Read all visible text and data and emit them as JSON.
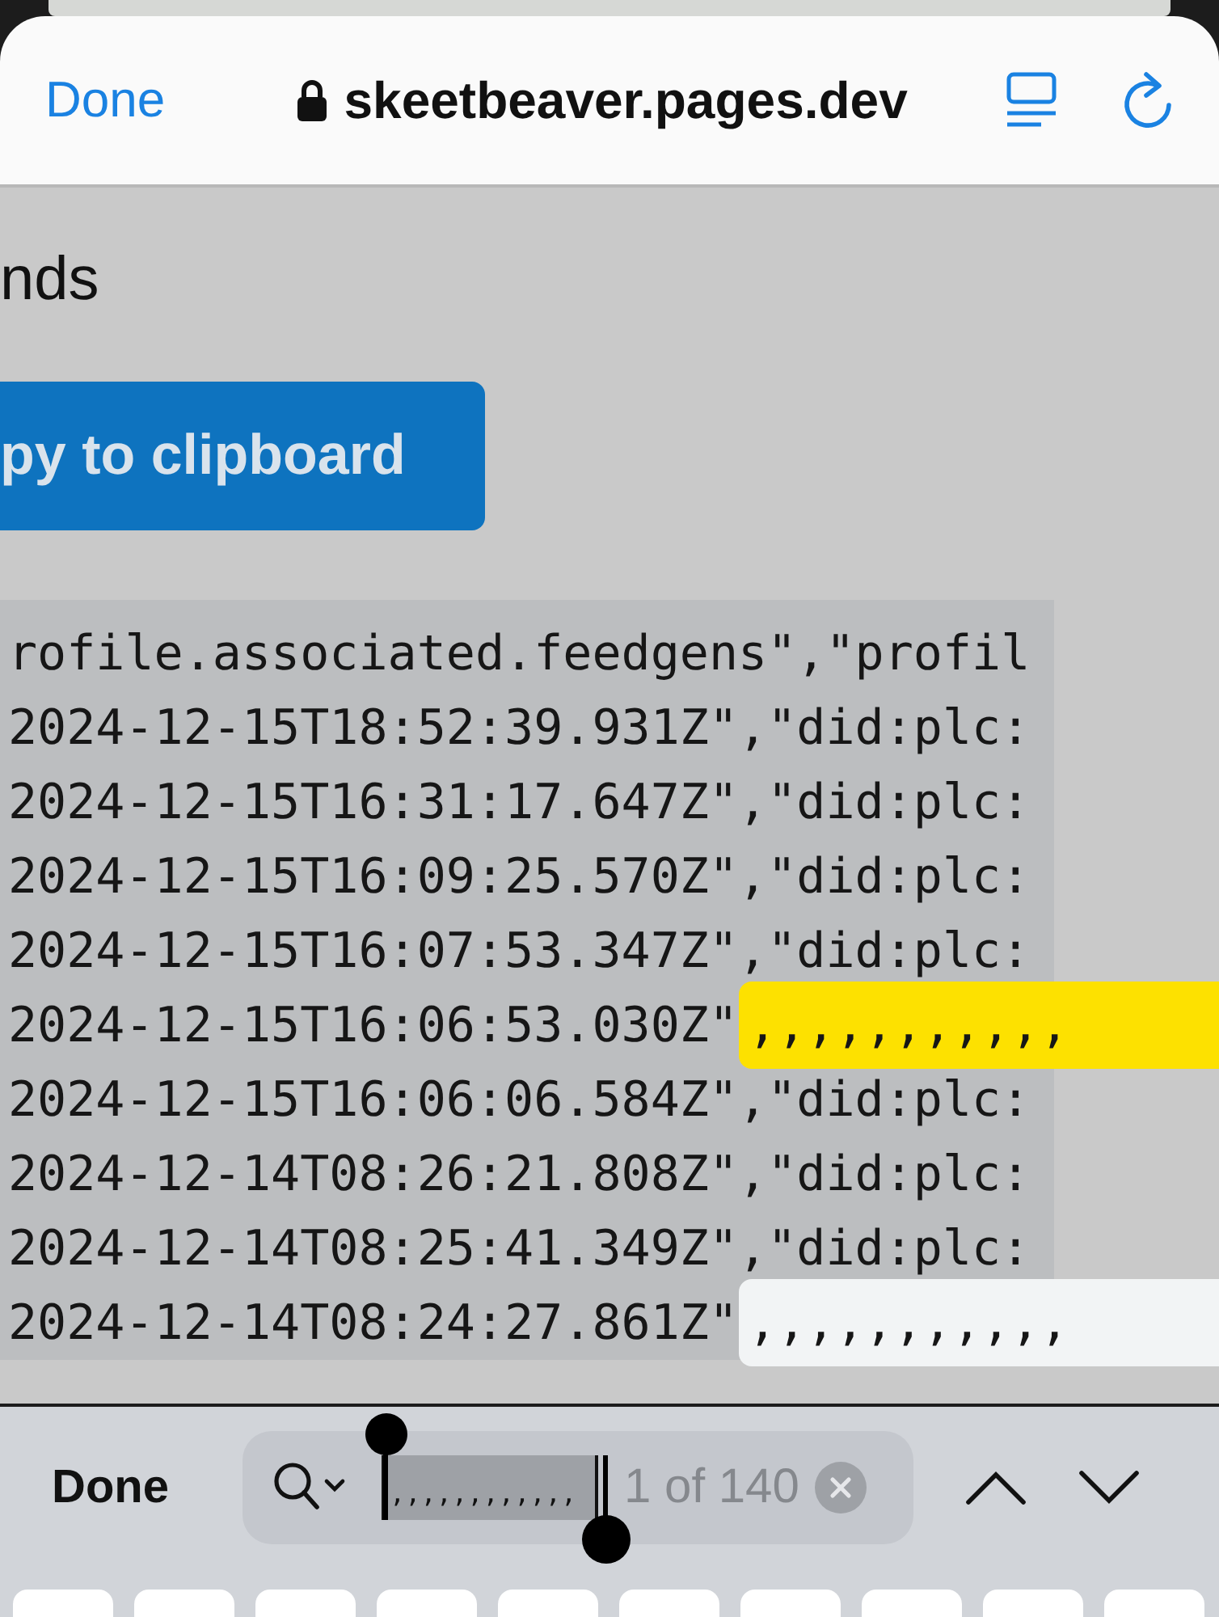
{
  "browser": {
    "done_label": "Done",
    "url": "skeetbeaver.pages.dev"
  },
  "page": {
    "heading": "nds",
    "copy_button": "py to clipboard",
    "code_lines": [
      {
        "kind": "plain",
        "text": "rofile.associated.feedgens\",\"profil"
      },
      {
        "kind": "plain",
        "text": "2024-12-15T18:52:39.931Z\",\"did:plc:"
      },
      {
        "kind": "plain",
        "text": "2024-12-15T16:31:17.647Z\",\"did:plc:"
      },
      {
        "kind": "plain",
        "text": "2024-12-15T16:09:25.570Z\",\"did:plc:"
      },
      {
        "kind": "plain",
        "text": "2024-12-15T16:07:53.347Z\",\"did:plc:"
      },
      {
        "kind": "match",
        "text": "2024-12-15T16:06:53.030Z\"",
        "match": ",,,,,,,,,,,",
        "current": true
      },
      {
        "kind": "plain",
        "text": "2024-12-15T16:06:06.584Z\",\"did:plc:"
      },
      {
        "kind": "plain",
        "text": "2024-12-14T08:26:21.808Z\",\"did:plc:"
      },
      {
        "kind": "plain",
        "text": "2024-12-14T08:25:41.349Z\",\"did:plc:"
      },
      {
        "kind": "match",
        "text": "2024-12-14T08:24:27.861Z\"",
        "match": ",,,,,,,,,,,",
        "current": false
      }
    ]
  },
  "find_bar": {
    "done_label": "Done",
    "query": ",,,,,,,,,,,,",
    "count": "1 of 140"
  }
}
